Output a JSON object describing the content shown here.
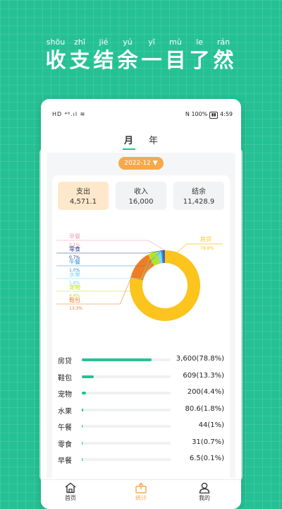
{
  "hero": {
    "chars": [
      {
        "py": "shōu",
        "zh": "收"
      },
      {
        "py": "zhī",
        "zh": "支"
      },
      {
        "py": "jié",
        "zh": "结"
      },
      {
        "py": "yú",
        "zh": "余"
      },
      {
        "py": "yī",
        "zh": "一"
      },
      {
        "py": "mù",
        "zh": "目"
      },
      {
        "py": "le",
        "zh": "了"
      },
      {
        "py": "rán",
        "zh": "然"
      }
    ]
  },
  "status": {
    "left": "HD ⁴⁶.ıl ≋",
    "right": "N 100%",
    "battery": "▮▮",
    "time": "4:59"
  },
  "tabs": {
    "month": "月",
    "year": "年"
  },
  "month_selector": "2022-12 ▼",
  "summary": {
    "expense_label": "支出",
    "expense_value": "4,571.1",
    "income_label": "收入",
    "income_value": "16,000",
    "balance_label": "结余",
    "balance_value": "11,428.9"
  },
  "colors": {
    "accent": "#25c194",
    "orange": "#f6a84b",
    "donut_main": "#fcc41c",
    "brand_bg": "#25c194"
  },
  "chart_data": {
    "type": "pie",
    "donut": true,
    "slices": [
      {
        "label": "房贷",
        "pct": "78.8%",
        "value": 78.8,
        "color": "#fcc41c"
      },
      {
        "label": "鞋包",
        "pct": "13.3%",
        "value": 13.3,
        "color": "#f07c26"
      },
      {
        "label": "宠物",
        "pct": "4.4%",
        "value": 4.4,
        "color": "#b6e324"
      },
      {
        "label": "水果",
        "pct": "1.8%",
        "value": 1.8,
        "color": "#7ad9f5"
      },
      {
        "label": "午餐",
        "pct": "1.0%",
        "value": 1.0,
        "color": "#2f8fcf"
      },
      {
        "label": "零食",
        "pct": "0.7%",
        "value": 0.7,
        "color": "#2e3f8f"
      },
      {
        "label": "早餐",
        "pct": "0.1%",
        "value": 0.1,
        "color": "#f29bb0"
      }
    ]
  },
  "list": {
    "rows": [
      {
        "name": "房贷",
        "amount": "3,600(78.8%)",
        "pct": 78.8
      },
      {
        "name": "鞋包",
        "amount": "609(13.3%)",
        "pct": 13.3
      },
      {
        "name": "宠物",
        "amount": "200(4.4%)",
        "pct": 4.4
      },
      {
        "name": "水果",
        "amount": "80.6(1.8%)",
        "pct": 1.8
      },
      {
        "name": "午餐",
        "amount": "44(1%)",
        "pct": 1.0
      },
      {
        "name": "零食",
        "amount": "31(0.7%)",
        "pct": 0.7
      },
      {
        "name": "早餐",
        "amount": "6.5(0.1%)",
        "pct": 0.1
      }
    ]
  },
  "nav": {
    "home": "首页",
    "stats": "统计",
    "mine": "我的"
  }
}
